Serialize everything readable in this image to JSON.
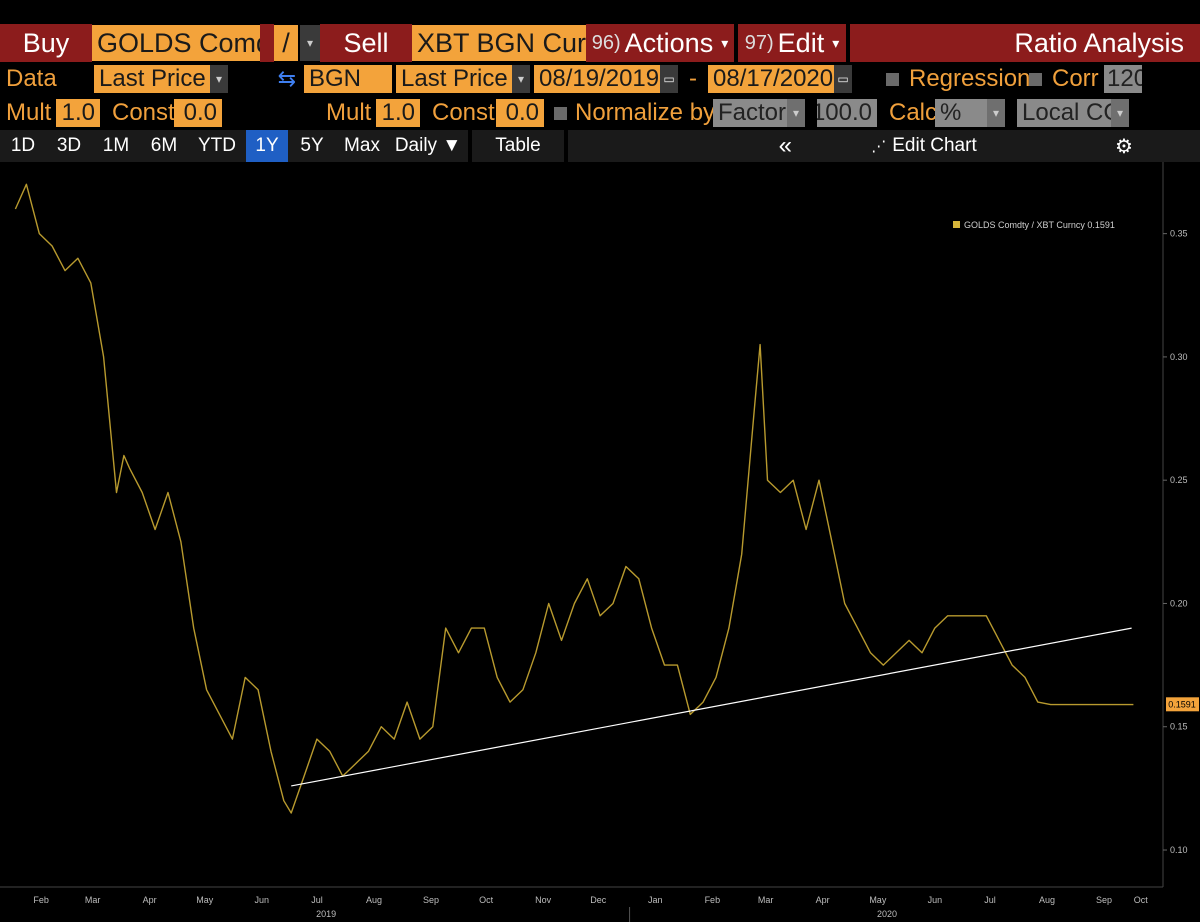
{
  "toolbar1": {
    "buy_label": "Buy",
    "buy_ticker": "GOLDS Comdty",
    "operator": "/",
    "sell_label": "Sell",
    "sell_ticker": "XBT BGN Curnc",
    "actions_num": "96)",
    "actions_label": "Actions",
    "edit_num": "97)",
    "edit_label": "Edit",
    "title": "Ratio Analysis"
  },
  "toolbar2": {
    "data_label": "Data",
    "data_field": "Last Price",
    "source": "BGN",
    "field2": "Last Price",
    "start_date": "08/19/2019",
    "dash": "-",
    "end_date": "08/17/2020",
    "regression_label": "Regression",
    "corr_label": "Corr",
    "corr_value": "120"
  },
  "toolbar3": {
    "mult1_label": "Mult",
    "mult1_value": "1.0",
    "const1_label": "Const",
    "const1_value": "0.0",
    "mult2_label": "Mult",
    "mult2_value": "1.0",
    "const2_label": "Const",
    "const2_value": "0.0",
    "normalize_label": "Normalize by",
    "normalize_value": "Factor",
    "factor_value": "100.0",
    "calc_label": "Calc",
    "calc_value": "%",
    "ccy_value": "Local CCY"
  },
  "toolbar4": {
    "periods": [
      "1D",
      "3D",
      "1M",
      "6M",
      "YTD",
      "1Y",
      "5Y",
      "Max"
    ],
    "active_period": "1Y",
    "frequency": "Daily ▼",
    "table_label": "Table",
    "collapse": "«",
    "edit_chart": "Edit Chart",
    "settings_icon": "gear-icon"
  },
  "colors": {
    "accent": "#f3a33b",
    "header_red": "#8c1c1c",
    "series": "#b89a2e",
    "trendline": "#ffffff",
    "active_tab": "#1f5fc4"
  },
  "chart_data": {
    "type": "line",
    "legend": "GOLDS Comdty / XBT Curncy 0.1591",
    "last_value_label": "0.1591",
    "x_ticks": [
      "Feb",
      "Mar",
      "Apr",
      "May",
      "Jun",
      "Jul",
      "Aug",
      "Sep",
      "Oct",
      "Nov",
      "Dec",
      "Jan",
      "Feb",
      "Mar",
      "Apr",
      "May",
      "Jun",
      "Jul",
      "Aug",
      "Sep",
      "Oct"
    ],
    "year_labels": [
      "2019",
      "2020"
    ],
    "y_ticks": [
      "0.10",
      "0.15",
      "0.20",
      "0.25",
      "0.30",
      "0.35"
    ],
    "ylim": [
      0.085,
      0.375
    ],
    "x": [
      "2019-02-01",
      "2019-02-07",
      "2019-02-14",
      "2019-02-21",
      "2019-02-28",
      "2019-03-07",
      "2019-03-14",
      "2019-03-21",
      "2019-03-28",
      "2019-04-01",
      "2019-04-04",
      "2019-04-11",
      "2019-04-18",
      "2019-04-25",
      "2019-05-02",
      "2019-05-09",
      "2019-05-16",
      "2019-05-23",
      "2019-05-30",
      "2019-06-06",
      "2019-06-13",
      "2019-06-20",
      "2019-06-27",
      "2019-07-01",
      "2019-07-08",
      "2019-07-15",
      "2019-07-22",
      "2019-07-29",
      "2019-08-05",
      "2019-08-12",
      "2019-08-19",
      "2019-08-26",
      "2019-09-02",
      "2019-09-09",
      "2019-09-16",
      "2019-09-23",
      "2019-09-30",
      "2019-10-07",
      "2019-10-14",
      "2019-10-21",
      "2019-10-28",
      "2019-11-04",
      "2019-11-11",
      "2019-11-18",
      "2019-11-25",
      "2019-12-02",
      "2019-12-09",
      "2019-12-16",
      "2019-12-23",
      "2019-12-30",
      "2020-01-06",
      "2020-01-13",
      "2020-01-20",
      "2020-01-27",
      "2020-02-03",
      "2020-02-10",
      "2020-02-17",
      "2020-02-24",
      "2020-03-02",
      "2020-03-09",
      "2020-03-12",
      "2020-03-16",
      "2020-03-23",
      "2020-03-30",
      "2020-04-06",
      "2020-04-13",
      "2020-04-20",
      "2020-04-27",
      "2020-05-04",
      "2020-05-11",
      "2020-05-18",
      "2020-05-25",
      "2020-06-01",
      "2020-06-08",
      "2020-06-15",
      "2020-06-22",
      "2020-06-29",
      "2020-07-06",
      "2020-07-13",
      "2020-07-20",
      "2020-07-27",
      "2020-08-03",
      "2020-08-10",
      "2020-08-17",
      "2020-09-01",
      "2020-09-15",
      "2020-10-01"
    ],
    "y": [
      0.36,
      0.37,
      0.35,
      0.345,
      0.335,
      0.34,
      0.33,
      0.3,
      0.245,
      0.26,
      0.255,
      0.245,
      0.23,
      0.245,
      0.225,
      0.19,
      0.165,
      0.155,
      0.145,
      0.17,
      0.165,
      0.14,
      0.12,
      0.115,
      0.13,
      0.145,
      0.14,
      0.13,
      0.135,
      0.14,
      0.15,
      0.145,
      0.16,
      0.145,
      0.15,
      0.19,
      0.18,
      0.19,
      0.19,
      0.17,
      0.16,
      0.165,
      0.18,
      0.2,
      0.185,
      0.2,
      0.21,
      0.195,
      0.2,
      0.215,
      0.21,
      0.19,
      0.175,
      0.175,
      0.155,
      0.16,
      0.17,
      0.19,
      0.22,
      0.28,
      0.305,
      0.25,
      0.245,
      0.25,
      0.23,
      0.25,
      0.225,
      0.2,
      0.19,
      0.18,
      0.175,
      0.18,
      0.185,
      0.18,
      0.19,
      0.195,
      0.195,
      0.195,
      0.195,
      0.185,
      0.175,
      0.17,
      0.16,
      0.159,
      0.159,
      0.159,
      0.159
    ],
    "trendline": {
      "x": [
        "2019-07-01",
        "2020-09-30"
      ],
      "y": [
        0.126,
        0.19
      ]
    },
    "grid": false,
    "legend_position": "top-right"
  }
}
